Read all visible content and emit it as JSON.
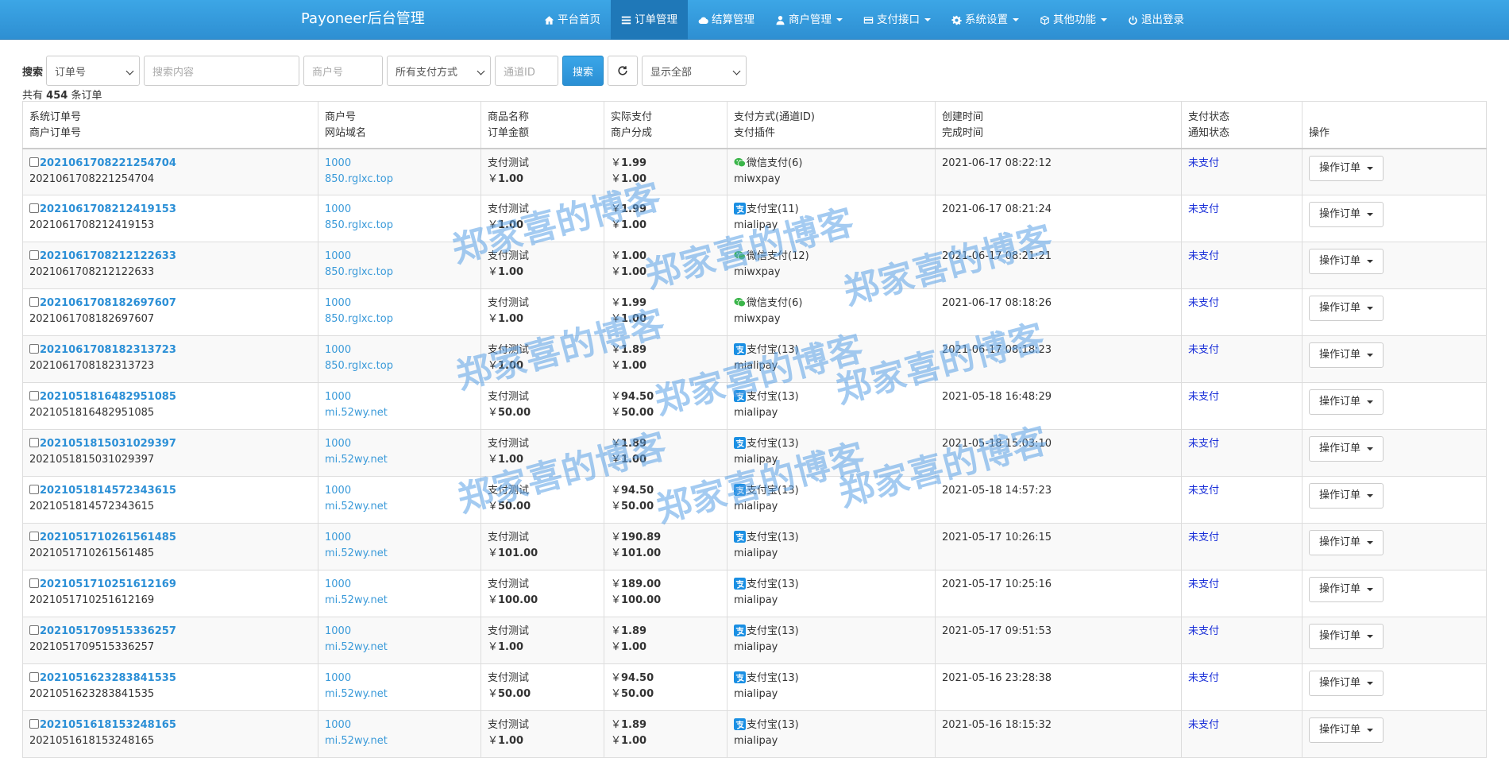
{
  "navbar": {
    "brand": "Payoneer后台管理",
    "items": [
      {
        "label": "平台首页",
        "icon": "home-icon",
        "active": false,
        "dropdown": false
      },
      {
        "label": "订单管理",
        "icon": "list-icon",
        "active": true,
        "dropdown": false
      },
      {
        "label": "结算管理",
        "icon": "cloud-icon",
        "active": false,
        "dropdown": false
      },
      {
        "label": "商户管理",
        "icon": "user-icon",
        "active": false,
        "dropdown": true
      },
      {
        "label": "支付接口",
        "icon": "credit-card-icon",
        "active": false,
        "dropdown": true
      },
      {
        "label": "系统设置",
        "icon": "gear-icon",
        "active": false,
        "dropdown": true
      },
      {
        "label": "其他功能",
        "icon": "cube-icon",
        "active": false,
        "dropdown": true
      },
      {
        "label": "退出登录",
        "icon": "power-icon",
        "active": false,
        "dropdown": false
      }
    ]
  },
  "search": {
    "label": "搜索",
    "field_select": "订单号",
    "content_placeholder": "搜索内容",
    "merchant_placeholder": "商户号",
    "pay_method_select": "所有支付方式",
    "channel_placeholder": "通道ID",
    "search_button": "搜索",
    "display_select": "显示全部"
  },
  "summary": {
    "prefix": "共有",
    "count": "454",
    "suffix": "条订单"
  },
  "table": {
    "headers": [
      [
        "系统订单号",
        "商户订单号"
      ],
      [
        "商户号",
        "网站域名"
      ],
      [
        "商品名称",
        "订单金额"
      ],
      [
        "实际支付",
        "商户分成"
      ],
      [
        "支付方式(通道ID)",
        "支付插件"
      ],
      [
        "创建时间",
        "完成时间"
      ],
      [
        "支付状态",
        "通知状态"
      ],
      [
        "",
        "操作"
      ]
    ],
    "op_button": "操作订单",
    "rows": [
      {
        "sys_no": "2021061708221254704",
        "mch_no": "2021061708221254704",
        "uid": "1000",
        "domain": "850.rglxc.top",
        "product": "支付测试",
        "amount": "1.00",
        "realpay": "1.99",
        "share": "1.00",
        "pay_type": "wx",
        "pay_name": "微信支付(6)",
        "plugin": "miwxpay",
        "created": "2021-06-17 08:22:12",
        "status": "未支付"
      },
      {
        "sys_no": "2021061708212419153",
        "mch_no": "2021061708212419153",
        "uid": "1000",
        "domain": "850.rglxc.top",
        "product": "支付测试",
        "amount": "1.00",
        "realpay": "1.99",
        "share": "1.00",
        "pay_type": "ali",
        "pay_name": "支付宝(11)",
        "plugin": "mialipay",
        "created": "2021-06-17 08:21:24",
        "status": "未支付"
      },
      {
        "sys_no": "2021061708212122633",
        "mch_no": "2021061708212122633",
        "uid": "1000",
        "domain": "850.rglxc.top",
        "product": "支付测试",
        "amount": "1.00",
        "realpay": "1.00",
        "share": "1.00",
        "pay_type": "wx",
        "pay_name": "微信支付(12)",
        "plugin": "miwxpay",
        "created": "2021-06-17 08:21:21",
        "status": "未支付"
      },
      {
        "sys_no": "2021061708182697607",
        "mch_no": "2021061708182697607",
        "uid": "1000",
        "domain": "850.rglxc.top",
        "product": "支付测试",
        "amount": "1.00",
        "realpay": "1.99",
        "share": "1.00",
        "pay_type": "wx",
        "pay_name": "微信支付(6)",
        "plugin": "miwxpay",
        "created": "2021-06-17 08:18:26",
        "status": "未支付"
      },
      {
        "sys_no": "2021061708182313723",
        "mch_no": "2021061708182313723",
        "uid": "1000",
        "domain": "850.rglxc.top",
        "product": "支付测试",
        "amount": "1.00",
        "realpay": "1.89",
        "share": "1.00",
        "pay_type": "ali",
        "pay_name": "支付宝(13)",
        "plugin": "mialipay",
        "created": "2021-06-17 08:18:23",
        "status": "未支付"
      },
      {
        "sys_no": "2021051816482951085",
        "mch_no": "2021051816482951085",
        "uid": "1000",
        "domain": "mi.52wy.net",
        "product": "支付测试",
        "amount": "50.00",
        "realpay": "94.50",
        "share": "50.00",
        "pay_type": "ali",
        "pay_name": "支付宝(13)",
        "plugin": "mialipay",
        "created": "2021-05-18 16:48:29",
        "status": "未支付"
      },
      {
        "sys_no": "2021051815031029397",
        "mch_no": "2021051815031029397",
        "uid": "1000",
        "domain": "mi.52wy.net",
        "product": "支付测试",
        "amount": "1.00",
        "realpay": "1.89",
        "share": "1.00",
        "pay_type": "ali",
        "pay_name": "支付宝(13)",
        "plugin": "mialipay",
        "created": "2021-05-18 15:03:10",
        "status": "未支付"
      },
      {
        "sys_no": "2021051814572343615",
        "mch_no": "2021051814572343615",
        "uid": "1000",
        "domain": "mi.52wy.net",
        "product": "支付测试",
        "amount": "50.00",
        "realpay": "94.50",
        "share": "50.00",
        "pay_type": "ali",
        "pay_name": "支付宝(13)",
        "plugin": "mialipay",
        "created": "2021-05-18 14:57:23",
        "status": "未支付"
      },
      {
        "sys_no": "2021051710261561485",
        "mch_no": "2021051710261561485",
        "uid": "1000",
        "domain": "mi.52wy.net",
        "product": "支付测试",
        "amount": "101.00",
        "realpay": "190.89",
        "share": "101.00",
        "pay_type": "ali",
        "pay_name": "支付宝(13)",
        "plugin": "mialipay",
        "created": "2021-05-17 10:26:15",
        "status": "未支付"
      },
      {
        "sys_no": "2021051710251612169",
        "mch_no": "2021051710251612169",
        "uid": "1000",
        "domain": "mi.52wy.net",
        "product": "支付测试",
        "amount": "100.00",
        "realpay": "189.00",
        "share": "100.00",
        "pay_type": "ali",
        "pay_name": "支付宝(13)",
        "plugin": "mialipay",
        "created": "2021-05-17 10:25:16",
        "status": "未支付"
      },
      {
        "sys_no": "2021051709515336257",
        "mch_no": "2021051709515336257",
        "uid": "1000",
        "domain": "mi.52wy.net",
        "product": "支付测试",
        "amount": "1.00",
        "realpay": "1.89",
        "share": "1.00",
        "pay_type": "ali",
        "pay_name": "支付宝(13)",
        "plugin": "mialipay",
        "created": "2021-05-17 09:51:53",
        "status": "未支付"
      },
      {
        "sys_no": "2021051623283841535",
        "mch_no": "2021051623283841535",
        "uid": "1000",
        "domain": "mi.52wy.net",
        "product": "支付测试",
        "amount": "50.00",
        "realpay": "94.50",
        "share": "50.00",
        "pay_type": "ali",
        "pay_name": "支付宝(13)",
        "plugin": "mialipay",
        "created": "2021-05-16 23:28:38",
        "status": "未支付"
      },
      {
        "sys_no": "2021051618153248165",
        "mch_no": "2021051618153248165",
        "uid": "1000",
        "domain": "mi.52wy.net",
        "product": "支付测试",
        "amount": "1.00",
        "realpay": "1.89",
        "share": "1.00",
        "pay_type": "ali",
        "pay_name": "支付宝(13)",
        "plugin": "mialipay",
        "created": "2021-05-16 18:15:32",
        "status": "未支付"
      }
    ]
  },
  "watermark": {
    "text": "郑家喜的博客"
  },
  "colors": {
    "navbar": "#3aa3e3",
    "link": "#3a9ad9",
    "unpaid": "#1a2fd8",
    "wechat": "#3bb54a",
    "alipay": "#1a8fe3"
  }
}
